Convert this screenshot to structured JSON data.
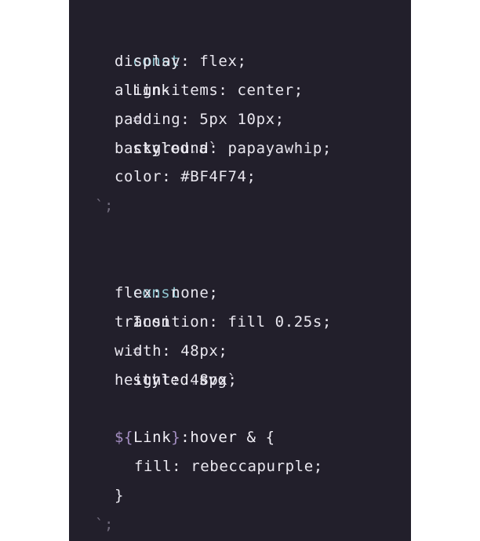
{
  "code": {
    "line1": {
      "kw": "const",
      "name": "Link",
      "eq": "=",
      "obj": "styled",
      "dot": ".",
      "tag": "a",
      "tick": "`"
    },
    "line2": {
      "text": "display: flex;"
    },
    "line3": {
      "text": "align-items: center;"
    },
    "line4": {
      "text": "padding: 5px 10px;"
    },
    "line5": {
      "text": "background: papayawhip;"
    },
    "line6": {
      "text": "color: #BF4F74;"
    },
    "line7": {
      "text": "`;"
    },
    "line9": {
      "kw": "const",
      "name": "Icon",
      "eq": "=",
      "obj": "styled",
      "dot": ".",
      "tag": "svg",
      "tick": "`"
    },
    "line10": {
      "text": "flex: none;"
    },
    "line11": {
      "text": "transition: fill 0.25s;"
    },
    "line12": {
      "text": "width: 48px;"
    },
    "line13": {
      "text": "height: 48px;"
    },
    "line15": {
      "open": "${",
      "ref": "Link",
      "close": "}",
      "rest": ":hover & {"
    },
    "line16": {
      "text": "fill: rebeccapurple;"
    },
    "line17": {
      "text": "}"
    },
    "line18": {
      "text": "`;"
    }
  }
}
